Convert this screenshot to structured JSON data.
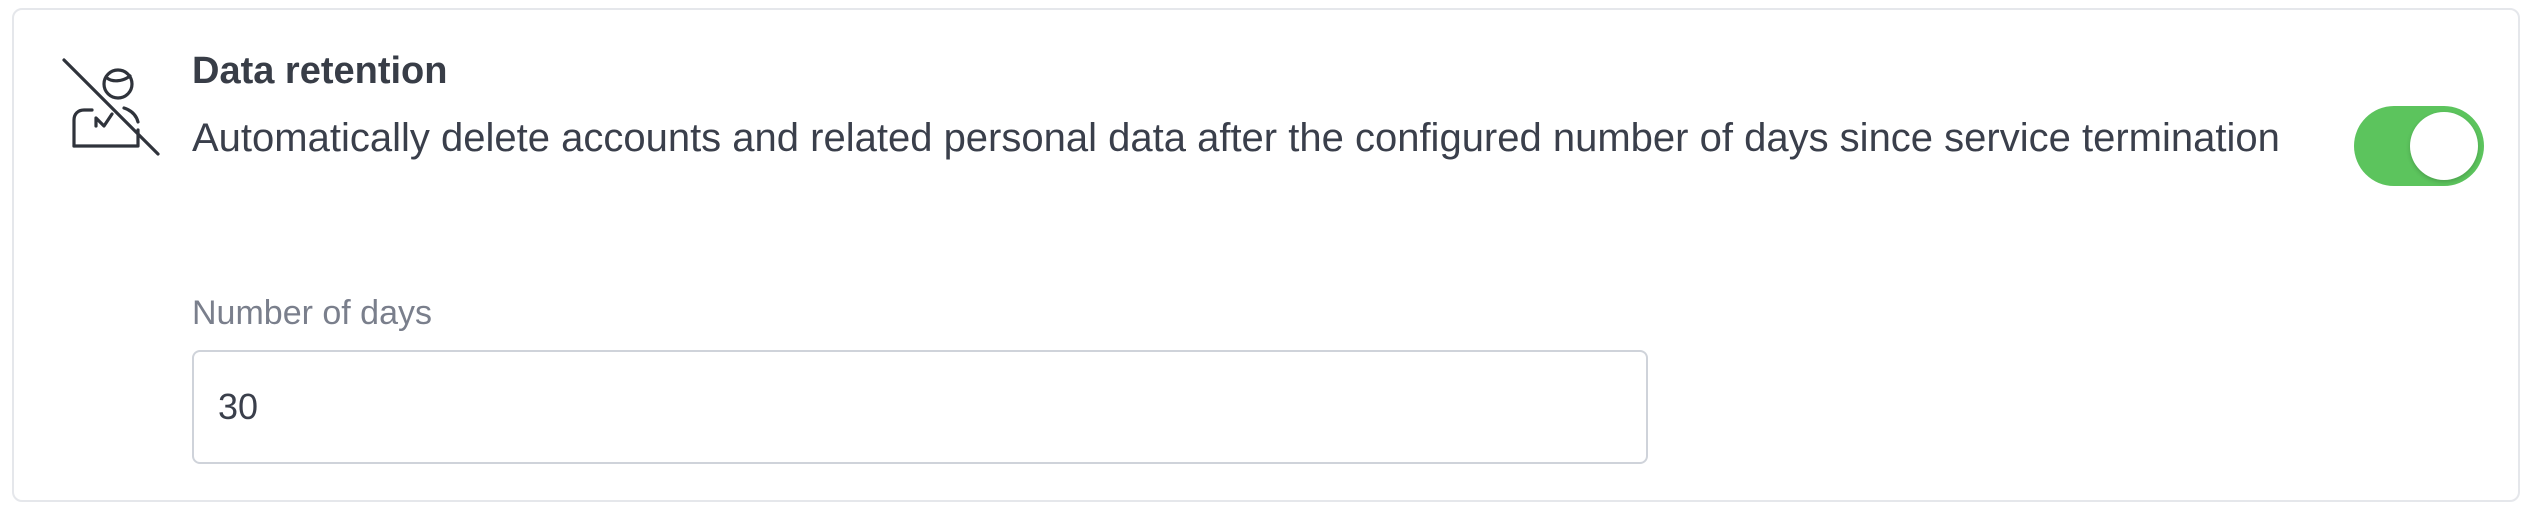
{
  "setting": {
    "icon": "person-slash-icon",
    "title": "Data retention",
    "description": "Automatically delete accounts and related personal data after the configured number of days since service termination",
    "enabled": true,
    "toggle_color": "#5cc45d"
  },
  "days_field": {
    "label": "Number of days",
    "value": "30"
  }
}
